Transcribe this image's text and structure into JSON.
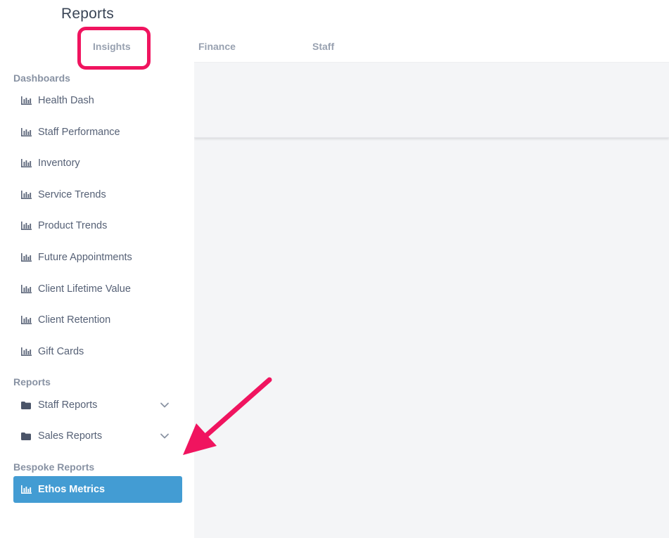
{
  "header": {
    "title": "Reports",
    "tabs": [
      {
        "label": "Insights"
      },
      {
        "label": "Finance"
      },
      {
        "label": "Staff"
      }
    ]
  },
  "sidebar": {
    "sections": [
      {
        "title": "Dashboards",
        "items": [
          {
            "label": "Health Dash",
            "icon": "bar-chart-icon"
          },
          {
            "label": "Staff Performance",
            "icon": "bar-chart-icon"
          },
          {
            "label": "Inventory",
            "icon": "bar-chart-icon"
          },
          {
            "label": "Service Trends",
            "icon": "bar-chart-icon"
          },
          {
            "label": "Product Trends",
            "icon": "bar-chart-icon"
          },
          {
            "label": "Future Appointments",
            "icon": "bar-chart-icon"
          },
          {
            "label": "Client Lifetime Value",
            "icon": "bar-chart-icon"
          },
          {
            "label": "Client Retention",
            "icon": "bar-chart-icon"
          },
          {
            "label": "Gift Cards",
            "icon": "bar-chart-icon"
          }
        ]
      },
      {
        "title": "Reports",
        "items": [
          {
            "label": "Staff Reports",
            "icon": "folder-icon"
          },
          {
            "label": "Sales Reports",
            "icon": "folder-icon"
          }
        ]
      },
      {
        "title": "Bespoke Reports",
        "items": [
          {
            "label": "Ethos Metrics",
            "icon": "bar-chart-icon",
            "active": true
          }
        ]
      }
    ]
  },
  "colors": {
    "accent": "#439cd3",
    "annotation": "#f0145f",
    "text": "#566176",
    "muted": "#8892a3",
    "content_bg": "#f4f5f7"
  }
}
